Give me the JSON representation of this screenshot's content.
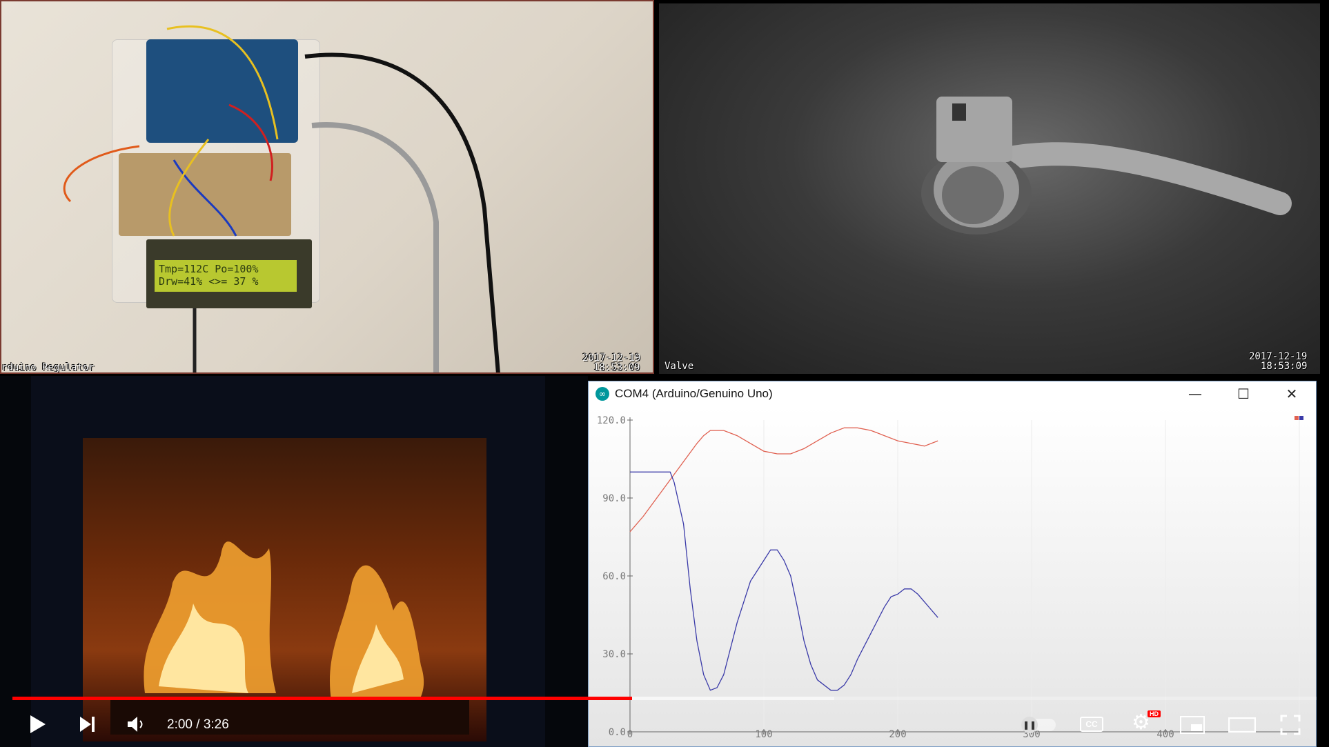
{
  "top_left_camera": {
    "label": "rduino Regulator",
    "date": "2017-12-19",
    "time": "18:53:09",
    "lcd_line1": "Tmp=112C Po=100%",
    "lcd_line2": "Drw=41% <>= 37 %"
  },
  "top_right_camera": {
    "label": "Valve",
    "date": "2017-12-19",
    "time": "18:53:09"
  },
  "plotter": {
    "title": "COM4 (Arduino/Genuino Uno)",
    "minimize_label": "—",
    "maximize_label": "☐",
    "close_label": "✕",
    "colors": {
      "series_a": "#e06050",
      "series_b": "#3a3aa8"
    }
  },
  "chart_data": {
    "type": "line",
    "ylim": [
      0,
      120
    ],
    "xlim": [
      0,
      500
    ],
    "y_ticks": [
      "120.0",
      "90.0",
      "60.0",
      "30.0",
      "0.0"
    ],
    "x_ticks": [
      "0",
      "100",
      "200",
      "300",
      "400"
    ],
    "series": [
      {
        "color": "#e06050",
        "x": [
          0,
          10,
          20,
          30,
          40,
          50,
          55,
          60,
          70,
          80,
          90,
          100,
          110,
          120,
          130,
          140,
          150,
          160,
          170,
          180,
          190,
          200,
          210,
          220,
          230
        ],
        "values": [
          77,
          83,
          90,
          97,
          104,
          111,
          114,
          116,
          116,
          114,
          111,
          108,
          107,
          107,
          109,
          112,
          115,
          117,
          117,
          116,
          114,
          112,
          111,
          110,
          112
        ]
      },
      {
        "color": "#3a3aa8",
        "x": [
          0,
          10,
          20,
          30,
          33,
          40,
          45,
          50,
          55,
          60,
          65,
          70,
          75,
          80,
          90,
          95,
          100,
          105,
          110,
          115,
          120,
          125,
          130,
          135,
          140,
          145,
          150,
          155,
          160,
          165,
          170,
          175,
          180,
          185,
          190,
          195,
          200,
          205,
          210,
          215,
          220,
          225,
          230
        ],
        "values": [
          100,
          100,
          100,
          100,
          96,
          80,
          55,
          35,
          22,
          16,
          17,
          22,
          32,
          42,
          58,
          62,
          66,
          70,
          70,
          66,
          60,
          48,
          35,
          26,
          20,
          18,
          16,
          16,
          18,
          22,
          28,
          33,
          38,
          43,
          48,
          52,
          53,
          55,
          55,
          53,
          50,
          47,
          44
        ]
      }
    ]
  },
  "player": {
    "time_label": "2:00 / 3:26",
    "progress_played": 0.475,
    "progress_buffered": 0.63,
    "hd_badge": "HD",
    "cc_label": "CC"
  }
}
